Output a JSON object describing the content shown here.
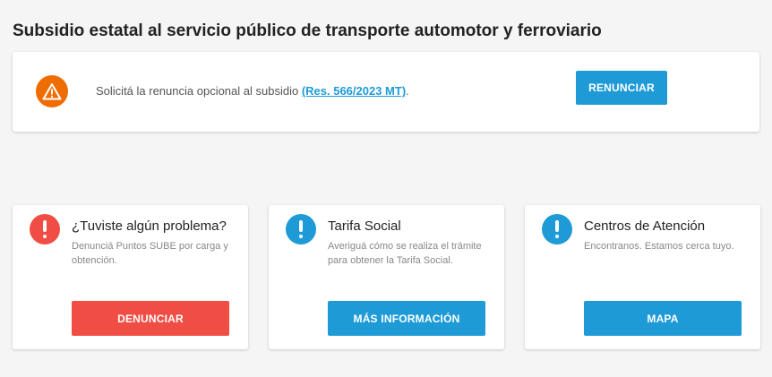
{
  "page": {
    "title": "Subsidio estatal al servicio público de transporte automotor y ferroviario"
  },
  "notice": {
    "icon": "warning-triangle-icon",
    "text": "Solicitá la renuncia opcional al subsidio ",
    "link_label": "(Res. 566/2023 MT)",
    "suffix": ".",
    "button_label": "RENUNCIAR"
  },
  "cards": [
    {
      "icon": "exclamation-icon",
      "icon_color": "#f04e45",
      "title": "¿Tuviste algún problema?",
      "description": "Denunciá Puntos SUBE por carga y obtención.",
      "button_label": "DENUNCIAR",
      "button_color": "#f04e45"
    },
    {
      "icon": "exclamation-icon",
      "icon_color": "#1e9bd7",
      "title": "Tarifa Social",
      "description": "Averiguá cómo se realiza el trámite para obtener la Tarifa Social.",
      "button_label": "MÁS INFORMACIÓN",
      "button_color": "#1e9bd7"
    },
    {
      "icon": "exclamation-icon",
      "icon_color": "#1e9bd7",
      "title": "Centros de Atención",
      "description": "Encontranos. Estamos cerca tuyo.",
      "button_label": "MAPA",
      "button_color": "#1e9bd7"
    }
  ],
  "colors": {
    "primary": "#1e9bd7",
    "danger": "#f04e45",
    "warning": "#ef6c00"
  }
}
